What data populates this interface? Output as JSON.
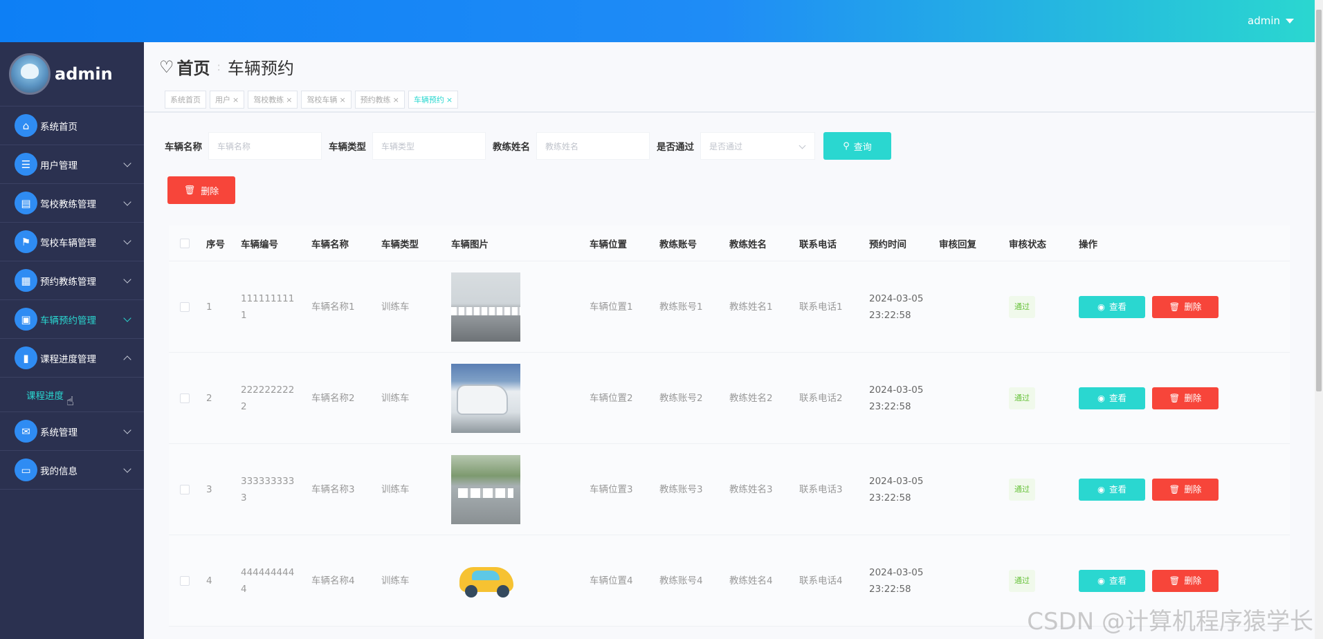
{
  "header": {
    "user_label": "admin"
  },
  "sidebar": {
    "profile_name": "admin",
    "items": [
      {
        "label": "系统首页",
        "icon": "home-icon"
      },
      {
        "label": "用户管理",
        "icon": "list-icon"
      },
      {
        "label": "驾校教练管理",
        "icon": "briefcase-icon"
      },
      {
        "label": "驾校车辆管理",
        "icon": "flag-icon"
      },
      {
        "label": "预约教练管理",
        "icon": "grid-icon"
      },
      {
        "label": "车辆预约管理",
        "icon": "clipboard-icon"
      },
      {
        "label": "课程进度管理",
        "icon": "bar-chart-icon"
      },
      {
        "label": "系统管理",
        "icon": "chat-icon"
      },
      {
        "label": "我的信息",
        "icon": "card-icon"
      }
    ],
    "submenu_label": "课程进度"
  },
  "breadcrumb": {
    "home": "首页",
    "current": "车辆预约"
  },
  "tags": [
    "系统首页",
    "用户",
    "驾校教练",
    "驾校车辆",
    "预约教练",
    "车辆预约"
  ],
  "search": {
    "vehicle_name_label": "车辆名称",
    "vehicle_name_placeholder": "车辆名称",
    "vehicle_type_label": "车辆类型",
    "vehicle_type_placeholder": "车辆类型",
    "coach_name_label": "教练姓名",
    "coach_name_placeholder": "教练姓名",
    "passed_label": "是否通过",
    "passed_placeholder": "是否通过",
    "query_label": "查询"
  },
  "delete_label": "删除",
  "table": {
    "headers": [
      "序号",
      "车辆编号",
      "车辆名称",
      "车辆类型",
      "车辆图片",
      "车辆位置",
      "教练账号",
      "教练姓名",
      "联系电话",
      "预约时间",
      "审核回复",
      "审核状态",
      "操作"
    ],
    "rows": [
      {
        "index": "1",
        "vehicle_no": "1111111111",
        "vehicle_name": "车辆名称1",
        "vehicle_type": "训练车",
        "location": "车辆位置1",
        "coach_account": "教练账号1",
        "coach_name": "教练姓名1",
        "phone": "联系电话1",
        "time": "2024-03-05 23:22:58",
        "reply": "",
        "status": "通过"
      },
      {
        "index": "2",
        "vehicle_no": "2222222222",
        "vehicle_name": "车辆名称2",
        "vehicle_type": "训练车",
        "location": "车辆位置2",
        "coach_account": "教练账号2",
        "coach_name": "教练姓名2",
        "phone": "联系电话2",
        "time": "2024-03-05 23:22:58",
        "reply": "",
        "status": "通过"
      },
      {
        "index": "3",
        "vehicle_no": "3333333333",
        "vehicle_name": "车辆名称3",
        "vehicle_type": "训练车",
        "location": "车辆位置3",
        "coach_account": "教练账号3",
        "coach_name": "教练姓名3",
        "phone": "联系电话3",
        "time": "2024-03-05 23:22:58",
        "reply": "",
        "status": "通过"
      },
      {
        "index": "4",
        "vehicle_no": "4444444444",
        "vehicle_name": "车辆名称4",
        "vehicle_type": "训练车",
        "location": "车辆位置4",
        "coach_account": "教练账号4",
        "coach_name": "教练姓名4",
        "phone": "联系电话4",
        "time": "2024-03-05 23:22:58",
        "reply": "",
        "status": "通过"
      }
    ],
    "view_label": "查看",
    "delete_label": "删除"
  },
  "watermark": "CSDN @计算机程序猿学长",
  "colors": {
    "accent": "#2ad7d0",
    "danger": "#f7453a",
    "sidebar": "#2b3150",
    "header_start": "#0d7ff5"
  }
}
